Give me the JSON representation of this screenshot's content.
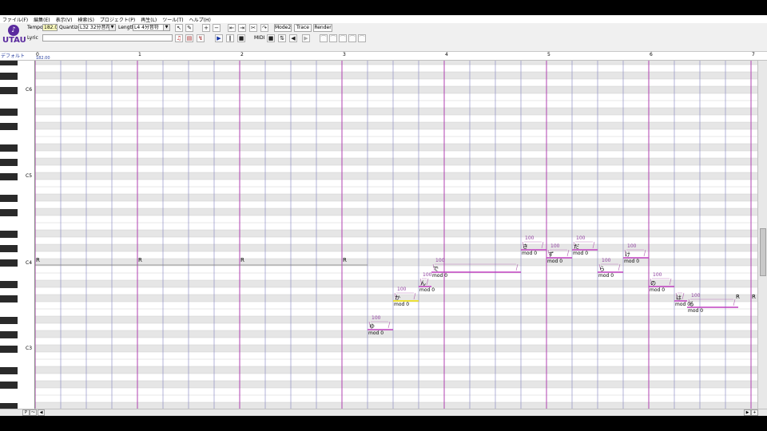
{
  "menu": [
    "ファイル(F)",
    "編集(E)",
    "表示(V)",
    "検索(S)",
    "プロジェクト(P)",
    "再生(L)",
    "ツール(T)",
    "ヘルプ(H)"
  ],
  "logo_text": "UTAU",
  "toolbar": {
    "tempo_label": "Tempo",
    "tempo_value": "182.0",
    "quantize_label": "Quantize",
    "quantize_value": "L32 32分音符",
    "length_label": "Length",
    "length_value": "L4  4分音符",
    "lyric_label": "Lyric",
    "lyric_value": "",
    "mode2_label": "Mode2",
    "trace_label": "Trace",
    "render_label": "Render",
    "midi_label": "MIDI"
  },
  "track": {
    "part_name": "デフォルト",
    "tempo_marker": "182.00",
    "bars": [
      "0",
      "1",
      "2",
      "3",
      "4",
      "5",
      "6",
      "7"
    ]
  },
  "octaves": [
    "C6",
    "C5",
    "C4",
    "C3"
  ],
  "rests": [
    "R",
    "R",
    "R",
    "R",
    "R",
    "R"
  ],
  "notes": [
    {
      "lyric": "ゆ",
      "vel": "100",
      "mod": "mod 0"
    },
    {
      "lyric": "か",
      "vel": "100",
      "mod": "mod 0"
    },
    {
      "lyric": "ん",
      "vel": "100",
      "mod": "mod 0"
    },
    {
      "lyric": "で",
      "vel": "100",
      "mod": "mod 0"
    },
    {
      "lyric": "き",
      "vel": "100",
      "mod": "mod 0"
    },
    {
      "lyric": "ず",
      "vel": "100",
      "mod": "mod 0"
    },
    {
      "lyric": "だ",
      "vel": "100",
      "mod": "mod 0"
    },
    {
      "lyric": "ら",
      "vel": "100",
      "mod": "mod 0"
    },
    {
      "lyric": "け",
      "vel": "100",
      "mod": "mod 0"
    },
    {
      "lyric": "の",
      "vel": "100",
      "mod": "mod 0"
    },
    {
      "lyric": "は",
      "vel": "",
      "mod": "mod 0"
    },
    {
      "lyric": "る",
      "vel": "100",
      "mod": "mod 0"
    }
  ],
  "colors": {
    "note_line": "#c040c0",
    "bar_line": "#b040b0",
    "beat_line": "#8080c0",
    "black_row": "#e6e6e6",
    "selected_note": "#f0e000"
  },
  "scroll": {
    "left_buttons": [
      "P",
      "〜"
    ]
  }
}
